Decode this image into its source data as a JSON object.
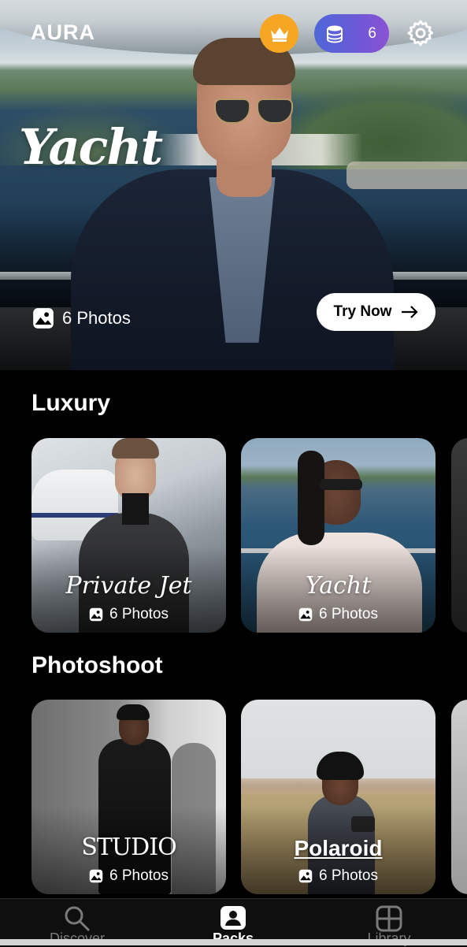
{
  "app": {
    "logo": "AURA"
  },
  "header": {
    "credits": "6",
    "premium_icon": "crown-icon",
    "credits_icon": "coins-icon",
    "settings_icon": "gear-icon"
  },
  "hero": {
    "title": "Yacht",
    "photo_count": "6 Photos",
    "cta": "Try Now",
    "cta_icon": "arrow-right-icon"
  },
  "sections": [
    {
      "title": "Luxury",
      "cards": [
        {
          "label": "Private Jet",
          "photo_count": "6 Photos"
        },
        {
          "label": "Yacht",
          "photo_count": "6 Photos"
        }
      ]
    },
    {
      "title": "Photoshoot",
      "cards": [
        {
          "label": "STUDIO",
          "photo_count": "6 Photos"
        },
        {
          "label": "Polaroid",
          "photo_count": "6 Photos"
        }
      ]
    }
  ],
  "nav": {
    "items": [
      {
        "label": "Discover",
        "icon": "search-icon",
        "active": false
      },
      {
        "label": "Packs",
        "icon": "person-card-icon",
        "active": true
      },
      {
        "label": "Library",
        "icon": "grid-icon",
        "active": false
      }
    ]
  },
  "colors": {
    "accent_gold": "#f6a623",
    "credits_gradient_start": "#4f68d8",
    "credits_gradient_end": "#8b52d4",
    "nav_active": "#ffffff",
    "nav_inactive": "#7a7a7a"
  }
}
